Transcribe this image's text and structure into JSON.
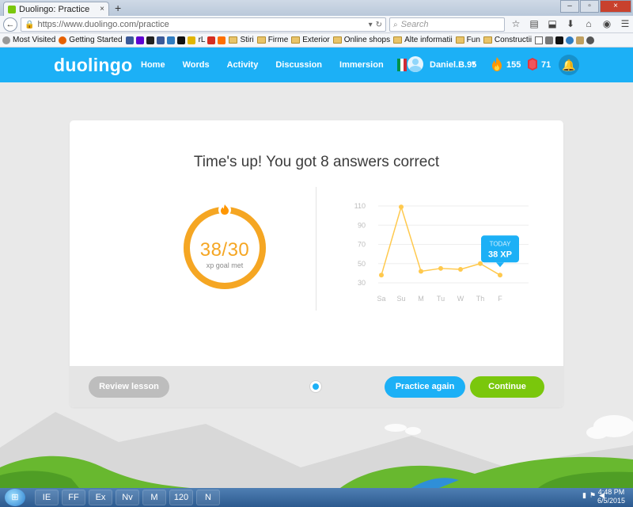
{
  "browser": {
    "tab_title": "Duolingo: Practice",
    "tab_close": "×",
    "new_tab": "+",
    "window_controls": {
      "minimize": "–",
      "maximize": "▫",
      "close": "×"
    },
    "url": "https://www.duolingo.com/practice",
    "url_dropdown": "▾",
    "reload": "↻",
    "search_placeholder": "Search",
    "back": "←",
    "bookmarks": [
      {
        "label": "Most Visited",
        "icon": "gear-icon"
      },
      {
        "label": "Getting Started",
        "icon": "firefox-icon"
      },
      {
        "label": "rL",
        "icon": "generic-icon"
      },
      {
        "label": "Stiri",
        "icon": "folder-icon"
      },
      {
        "label": "Firme",
        "icon": "folder-icon"
      },
      {
        "label": "Exterior",
        "icon": "folder-icon"
      },
      {
        "label": "Online shops",
        "icon": "folder-icon"
      },
      {
        "label": "Alte informatii",
        "icon": "folder-icon"
      },
      {
        "label": "Fun",
        "icon": "folder-icon"
      },
      {
        "label": "Constructii",
        "icon": "folder-icon"
      }
    ]
  },
  "duolingo": {
    "logo": "duolingo",
    "nav": [
      "Home",
      "Words",
      "Activity",
      "Discussion",
      "Immersion"
    ],
    "username": "Daniel.B.95",
    "streak": "155",
    "lingots": "71",
    "flag_colors": [
      "#009246",
      "#ffffff",
      "#ce2b37"
    ],
    "colors": {
      "brand_blue": "#1cb0f6",
      "green": "#7ac70c",
      "orange": "#f5a623",
      "lingot_red": "#e0363d"
    }
  },
  "result": {
    "title": "Time's up! You got 8 answers correct",
    "xp_ratio": "38/30",
    "xp_caption": "xp goal met",
    "xp_goal_progress": 1.0,
    "tooltip_label": "TODAY",
    "tooltip_value": "38 XP"
  },
  "actions": {
    "review": "Review lesson",
    "practice_again": "Practice again",
    "continue": "Continue"
  },
  "chart_data": {
    "type": "line",
    "categories": [
      "Sa",
      "Su",
      "M",
      "Tu",
      "W",
      "Th",
      "F"
    ],
    "values": [
      38,
      109,
      42,
      45,
      44,
      50,
      38
    ],
    "yticks": [
      110,
      90,
      70,
      50,
      30
    ],
    "ylim": [
      30,
      110
    ],
    "color": "#ffc94d",
    "grid": true
  },
  "taskbar": {
    "start_icon": "windows-start-icon",
    "apps": [
      "IE",
      "FF",
      "Ex",
      "Nv",
      "M",
      "120",
      "N"
    ],
    "time": "4:48 PM",
    "date": "6/5/2015"
  }
}
